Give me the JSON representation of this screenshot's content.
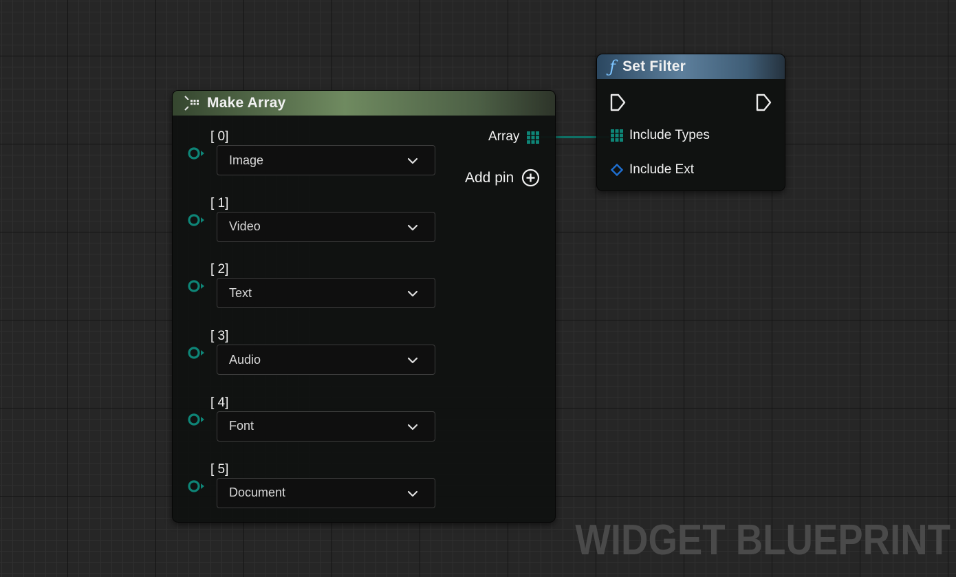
{
  "make_array": {
    "title": "Make Array",
    "items": [
      {
        "index_label": "[ 0]",
        "value": "Image"
      },
      {
        "index_label": "[ 1]",
        "value": "Video"
      },
      {
        "index_label": "[ 2]",
        "value": "Text"
      },
      {
        "index_label": "[ 3]",
        "value": "Audio"
      },
      {
        "index_label": "[ 4]",
        "value": "Font"
      },
      {
        "index_label": "[ 5]",
        "value": "Document"
      }
    ],
    "output_label": "Array",
    "add_pin_label": "Add pin",
    "header_icon": "make-array-icon"
  },
  "set_filter": {
    "title": "Set Filter",
    "header_icon": "function-icon",
    "pins": {
      "include_types": "Include Types",
      "include_ext": "Include Ext"
    }
  },
  "watermark": "WIDGET BLUEPRINT",
  "colors": {
    "array_pin": "#0e8577",
    "struct_pin": "#1f6fd0",
    "wire": "#0f7166",
    "make_array_header": "#6f8a60",
    "function_header": "#5d7f9c"
  }
}
